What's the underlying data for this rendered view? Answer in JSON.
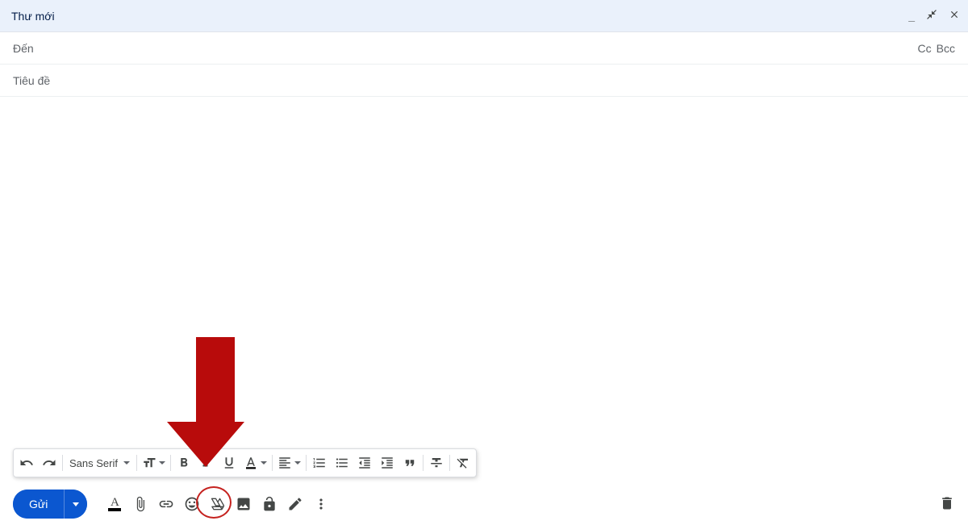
{
  "header": {
    "title": "Thư mới"
  },
  "recipients": {
    "to_label": "Đến",
    "cc_label": "Cc",
    "bcc_label": "Bcc"
  },
  "subject": {
    "placeholder": "Tiêu đề",
    "value": ""
  },
  "format": {
    "font_family": "Sans Serif"
  },
  "actions": {
    "send_label": "Gửi"
  }
}
